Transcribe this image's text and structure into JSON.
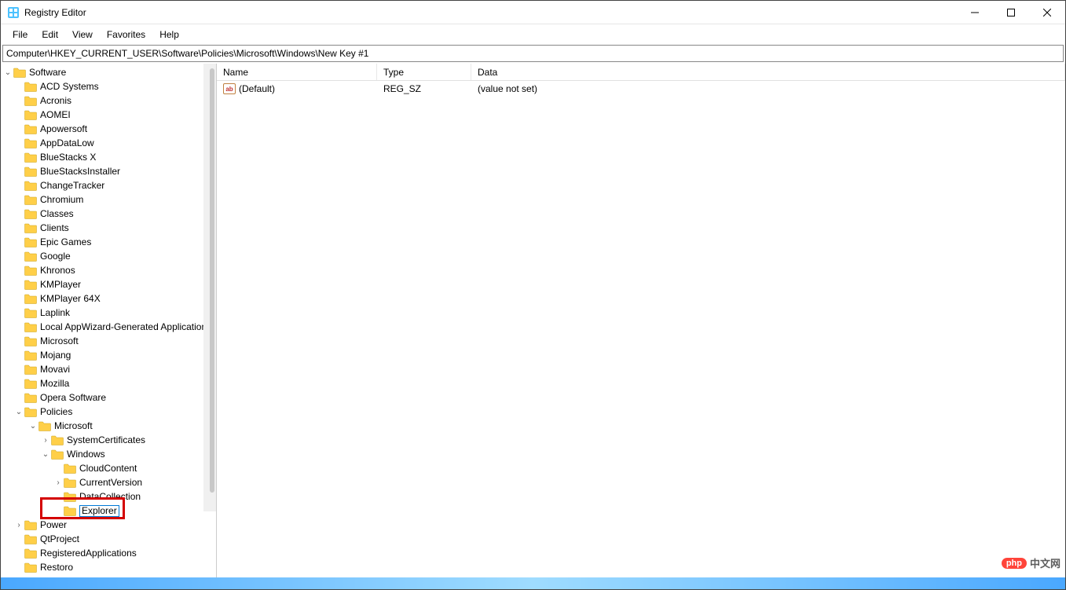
{
  "window": {
    "title": "Registry Editor"
  },
  "menu": {
    "file": "File",
    "edit": "Edit",
    "view": "View",
    "favorites": "Favorites",
    "help": "Help"
  },
  "address": "Computer\\HKEY_CURRENT_USER\\Software\\Policies\\Microsoft\\Windows\\New Key #1",
  "listheader": {
    "name": "Name",
    "type": "Type",
    "data": "Data"
  },
  "values": [
    {
      "name": "(Default)",
      "type": "REG_SZ",
      "data": "(value not set)"
    }
  ],
  "tree": {
    "root": "Software",
    "items": [
      "ACD Systems",
      "Acronis",
      "AOMEI",
      "Apowersoft",
      "AppDataLow",
      "BlueStacks X",
      "BlueStacksInstaller",
      "ChangeTracker",
      "Chromium",
      "Classes",
      "Clients",
      "Epic Games",
      "Google",
      "Khronos",
      "KMPlayer",
      "KMPlayer 64X",
      "Laplink",
      "Local AppWizard-Generated Applications",
      "Microsoft",
      "Mojang",
      "Movavi",
      "Mozilla",
      "Opera Software",
      "Policies"
    ],
    "policies": {
      "microsoft": "Microsoft",
      "systemcertificates": "SystemCertificates",
      "windows": "Windows",
      "cloudcontent": "CloudContent",
      "currentversion": "CurrentVersion",
      "datacollection": "DataCollection",
      "editing": "Explorer"
    },
    "tail": [
      "Power",
      "QtProject",
      "RegisteredApplications",
      "Restoro"
    ]
  },
  "watermark": {
    "badge": "php",
    "text": "中文网"
  }
}
